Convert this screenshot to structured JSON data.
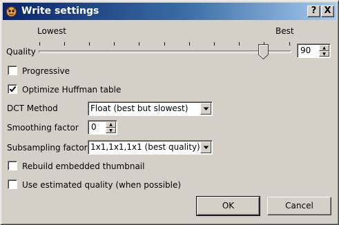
{
  "window": {
    "title": "Write settings",
    "help_label": "?",
    "close_label": "X"
  },
  "quality": {
    "label": "Quality",
    "min_label": "Lowest",
    "max_label": "Best",
    "value": "90",
    "slider_fraction": 0.9
  },
  "progressive": {
    "label": "Progressive",
    "checked": false
  },
  "optimize_huffman": {
    "label": "Optimize Huffman table",
    "checked": true
  },
  "dct_method": {
    "label": "DCT Method",
    "value": "Float (best but slowest)"
  },
  "smoothing": {
    "label": "Smoothing factor",
    "value": "0"
  },
  "subsampling": {
    "label": "Subsampling factor",
    "value": "1x1,1x1,1x1 (best quality)"
  },
  "rebuild_thumbnail": {
    "label": "Rebuild embedded thumbnail",
    "checked": false
  },
  "estimated_quality": {
    "label": "Use estimated quality (when possible)",
    "checked": false
  },
  "buttons": {
    "ok": "OK",
    "cancel": "Cancel"
  },
  "icons": {
    "app": "gimp-wilber-icon",
    "help": "help-icon",
    "close": "close-icon"
  }
}
